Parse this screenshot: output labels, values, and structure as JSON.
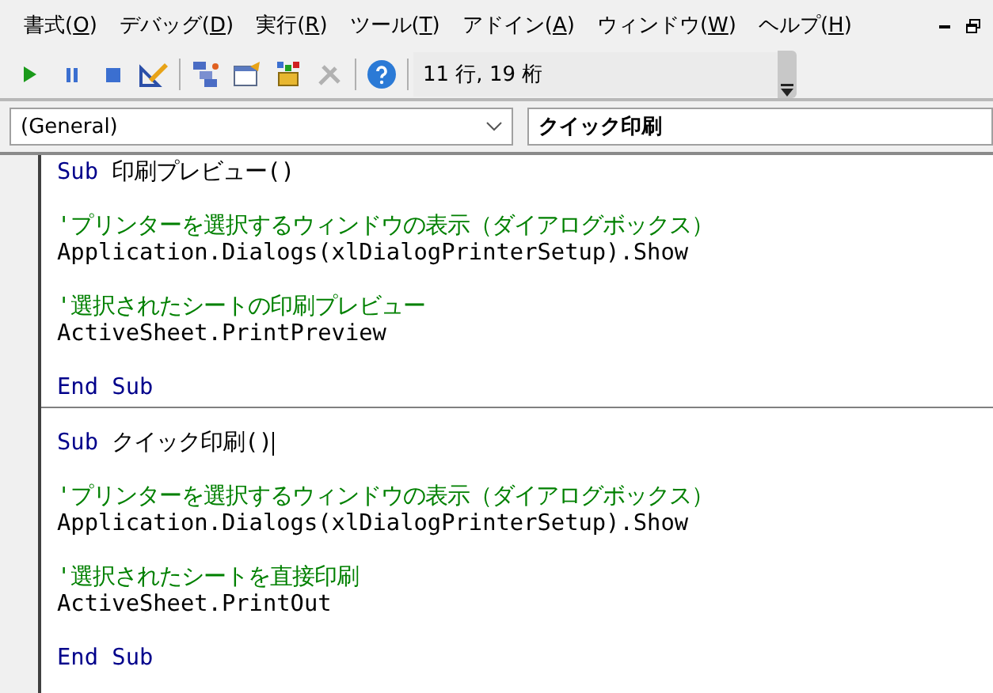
{
  "menu": [
    {
      "label": "書式(",
      "key": "O",
      "suffix": ")"
    },
    {
      "label": "デバッグ(",
      "key": "D",
      "suffix": ")"
    },
    {
      "label": "実行(",
      "key": "R",
      "suffix": ")"
    },
    {
      "label": "ツール(",
      "key": "T",
      "suffix": ")"
    },
    {
      "label": "アドイン(",
      "key": "A",
      "suffix": ")"
    },
    {
      "label": "ウィンドウ(",
      "key": "W",
      "suffix": ")"
    },
    {
      "label": "ヘルプ(",
      "key": "H",
      "suffix": ")"
    }
  ],
  "toolbar": [
    {
      "kind": "run",
      "disabled": false
    },
    {
      "kind": "pause",
      "disabled": false
    },
    {
      "kind": "stop",
      "disabled": false
    },
    {
      "kind": "design",
      "disabled": false
    },
    {
      "kind": "sep"
    },
    {
      "kind": "explorer",
      "disabled": false
    },
    {
      "kind": "properties",
      "disabled": false
    },
    {
      "kind": "browser",
      "disabled": false
    },
    {
      "kind": "toolbox",
      "disabled": true
    },
    {
      "kind": "sep"
    },
    {
      "kind": "help",
      "disabled": false
    },
    {
      "kind": "sep"
    }
  ],
  "position": "11 行, 19 桁",
  "object_combo": "(General)",
  "procedure_combo": "クイック印刷",
  "procedures": [
    {
      "lines": [
        {
          "kind": "code",
          "segments": [
            {
              "kind": "keyword",
              "text": "Sub"
            },
            {
              "kind": "plain",
              "text": " 印刷プレビュー()"
            }
          ]
        },
        {
          "kind": "blank"
        },
        {
          "kind": "code",
          "segments": [
            {
              "kind": "comment",
              "text": "'プリンターを選択するウィンドウの表示（ダイアログボックス）"
            }
          ]
        },
        {
          "kind": "code",
          "segments": [
            {
              "kind": "plain",
              "text": "Application.Dialogs(xlDialogPrinterSetup).Show"
            }
          ]
        },
        {
          "kind": "blank"
        },
        {
          "kind": "code",
          "segments": [
            {
              "kind": "comment",
              "text": "'選択されたシートの印刷プレビュー"
            }
          ]
        },
        {
          "kind": "code",
          "segments": [
            {
              "kind": "plain",
              "text": "ActiveSheet.PrintPreview"
            }
          ]
        },
        {
          "kind": "blank"
        },
        {
          "kind": "code",
          "segments": [
            {
              "kind": "keyword",
              "text": "End Sub"
            }
          ]
        }
      ]
    },
    {
      "lines": [
        {
          "kind": "code",
          "segments": [
            {
              "kind": "keyword",
              "text": "Sub"
            },
            {
              "kind": "plain",
              "text": " クイック印刷()",
              "caret": true
            }
          ]
        },
        {
          "kind": "blank"
        },
        {
          "kind": "code",
          "segments": [
            {
              "kind": "comment",
              "text": "'プリンターを選択するウィンドウの表示（ダイアログボックス）"
            }
          ]
        },
        {
          "kind": "code",
          "segments": [
            {
              "kind": "plain",
              "text": "Application.Dialogs(xlDialogPrinterSetup).Show"
            }
          ]
        },
        {
          "kind": "blank"
        },
        {
          "kind": "code",
          "segments": [
            {
              "kind": "comment",
              "text": "'選択されたシートを直接印刷"
            }
          ]
        },
        {
          "kind": "code",
          "segments": [
            {
              "kind": "plain",
              "text": "ActiveSheet.PrintOut"
            }
          ]
        },
        {
          "kind": "blank"
        },
        {
          "kind": "code",
          "segments": [
            {
              "kind": "keyword",
              "text": "End Sub"
            }
          ]
        }
      ]
    }
  ]
}
